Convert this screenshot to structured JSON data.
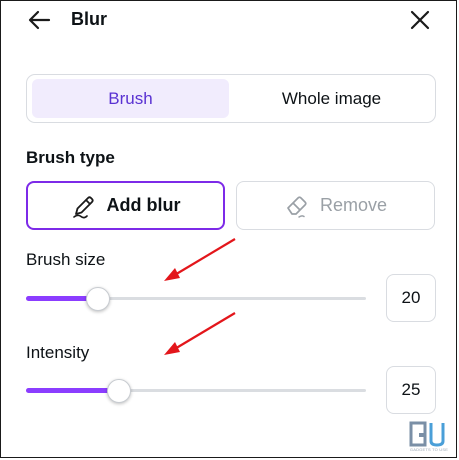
{
  "header": {
    "title": "Blur",
    "back_icon": "arrow-left-icon",
    "close_icon": "close-icon"
  },
  "tabs": [
    {
      "label": "Brush",
      "active": true
    },
    {
      "label": "Whole image",
      "active": false
    }
  ],
  "brush_type": {
    "heading": "Brush type",
    "options": [
      {
        "label": "Add blur",
        "icon": "pen-icon",
        "selected": true
      },
      {
        "label": "Remove",
        "icon": "eraser-icon",
        "selected": false
      }
    ]
  },
  "brush_size": {
    "label": "Brush size",
    "value": "20",
    "fraction": 0.21
  },
  "intensity": {
    "label": "Intensity",
    "value": "25",
    "fraction": 0.27
  },
  "annotations": {
    "arrow_color": "#e3161b"
  },
  "watermark": {
    "logo": "GU",
    "text": "GADGETS TO USE"
  },
  "colors": {
    "accent": "#7d2ae8",
    "slider_fill": "#8b3dff",
    "tab_active_bg": "#f1ecfd",
    "tab_active_text": "#5a32d2"
  }
}
